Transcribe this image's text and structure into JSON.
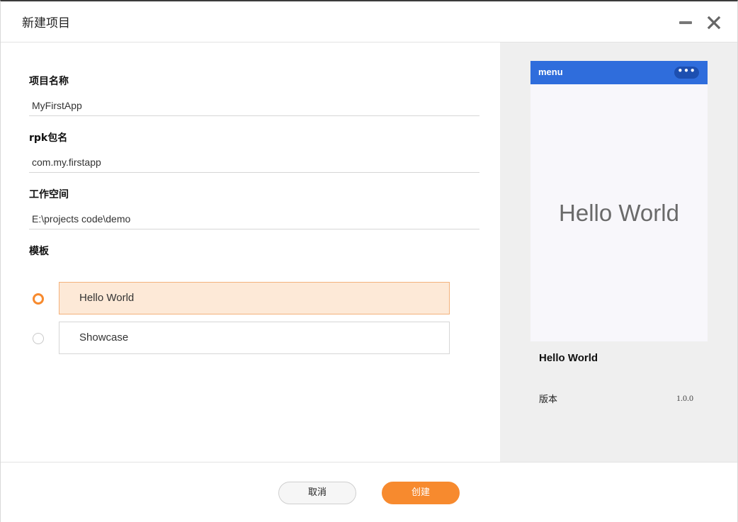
{
  "window": {
    "title": "新建项目"
  },
  "form": {
    "project_name": {
      "label": "项目名称",
      "value": "MyFirstApp"
    },
    "rpk_package": {
      "label": "rpk包名",
      "value": "com.my.firstapp"
    },
    "workspace": {
      "label": "工作空间",
      "value": "E:\\projects code\\demo"
    },
    "template": {
      "label": "模板",
      "options": [
        {
          "label": "Hello World",
          "selected": true
        },
        {
          "label": "Showcase",
          "selected": false
        }
      ]
    }
  },
  "preview": {
    "menu_label": "menu",
    "more_icon": "•••",
    "hello_text": "Hello World",
    "template_name": "Hello World",
    "version_label": "版本",
    "version_value": "1.0.0"
  },
  "footer": {
    "cancel_label": "取消",
    "create_label": "创建"
  },
  "colors": {
    "accent": "#f78a2e",
    "selected_bg": "#fde9d7",
    "phone_bar": "#2f6ddc",
    "panel_bg": "#efefef"
  },
  "icons": {
    "minimize": "minimize-icon",
    "close": "close-icon",
    "more": "more-icon"
  }
}
